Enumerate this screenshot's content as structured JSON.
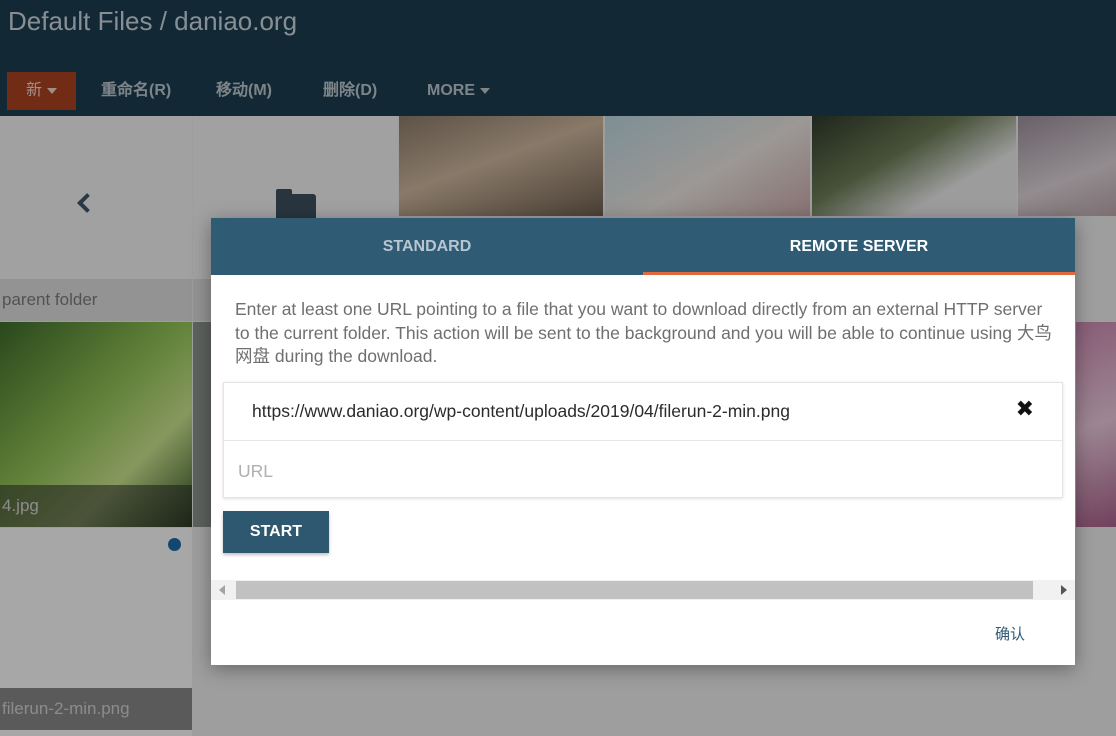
{
  "header": {
    "title": "Default Files / daniao.org",
    "toolbar": {
      "new_label": "新",
      "rename_label": "重命名(R)",
      "move_label": "移动(M)",
      "delete_label": "删除(D)",
      "more_label": "MORE"
    }
  },
  "grid": {
    "parent_label": "parent folder",
    "tile_jpg_label": "4.jpg",
    "tile_png_label": "filerun-2-min.png"
  },
  "dialog": {
    "tabs": [
      {
        "label": "STANDARD",
        "active": false
      },
      {
        "label": "REMOTE SERVER",
        "active": true
      }
    ],
    "description": "Enter at least one URL pointing to a file that you want to download directly from an external HTTP server to the current folder. This action will be sent to the background and you will be able to continue using 大鸟网盘 during the download.",
    "urls": [
      "https://www.daniao.org/wp-content/uploads/2019/04/filerun-2-min.png"
    ],
    "url_placeholder": "URL",
    "start_label": "START",
    "confirm_label": "确认"
  },
  "colors": {
    "header_bg": "#1c3c4f",
    "new_button_bg": "#a8401f",
    "tab_bar_bg": "#2f5b75",
    "active_tab_underline": "#e0693e",
    "start_button_bg": "#2e5770"
  },
  "icons": [
    "back-chevron-icon",
    "folder-icon",
    "remove-x-icon",
    "caret-down-icon"
  ]
}
